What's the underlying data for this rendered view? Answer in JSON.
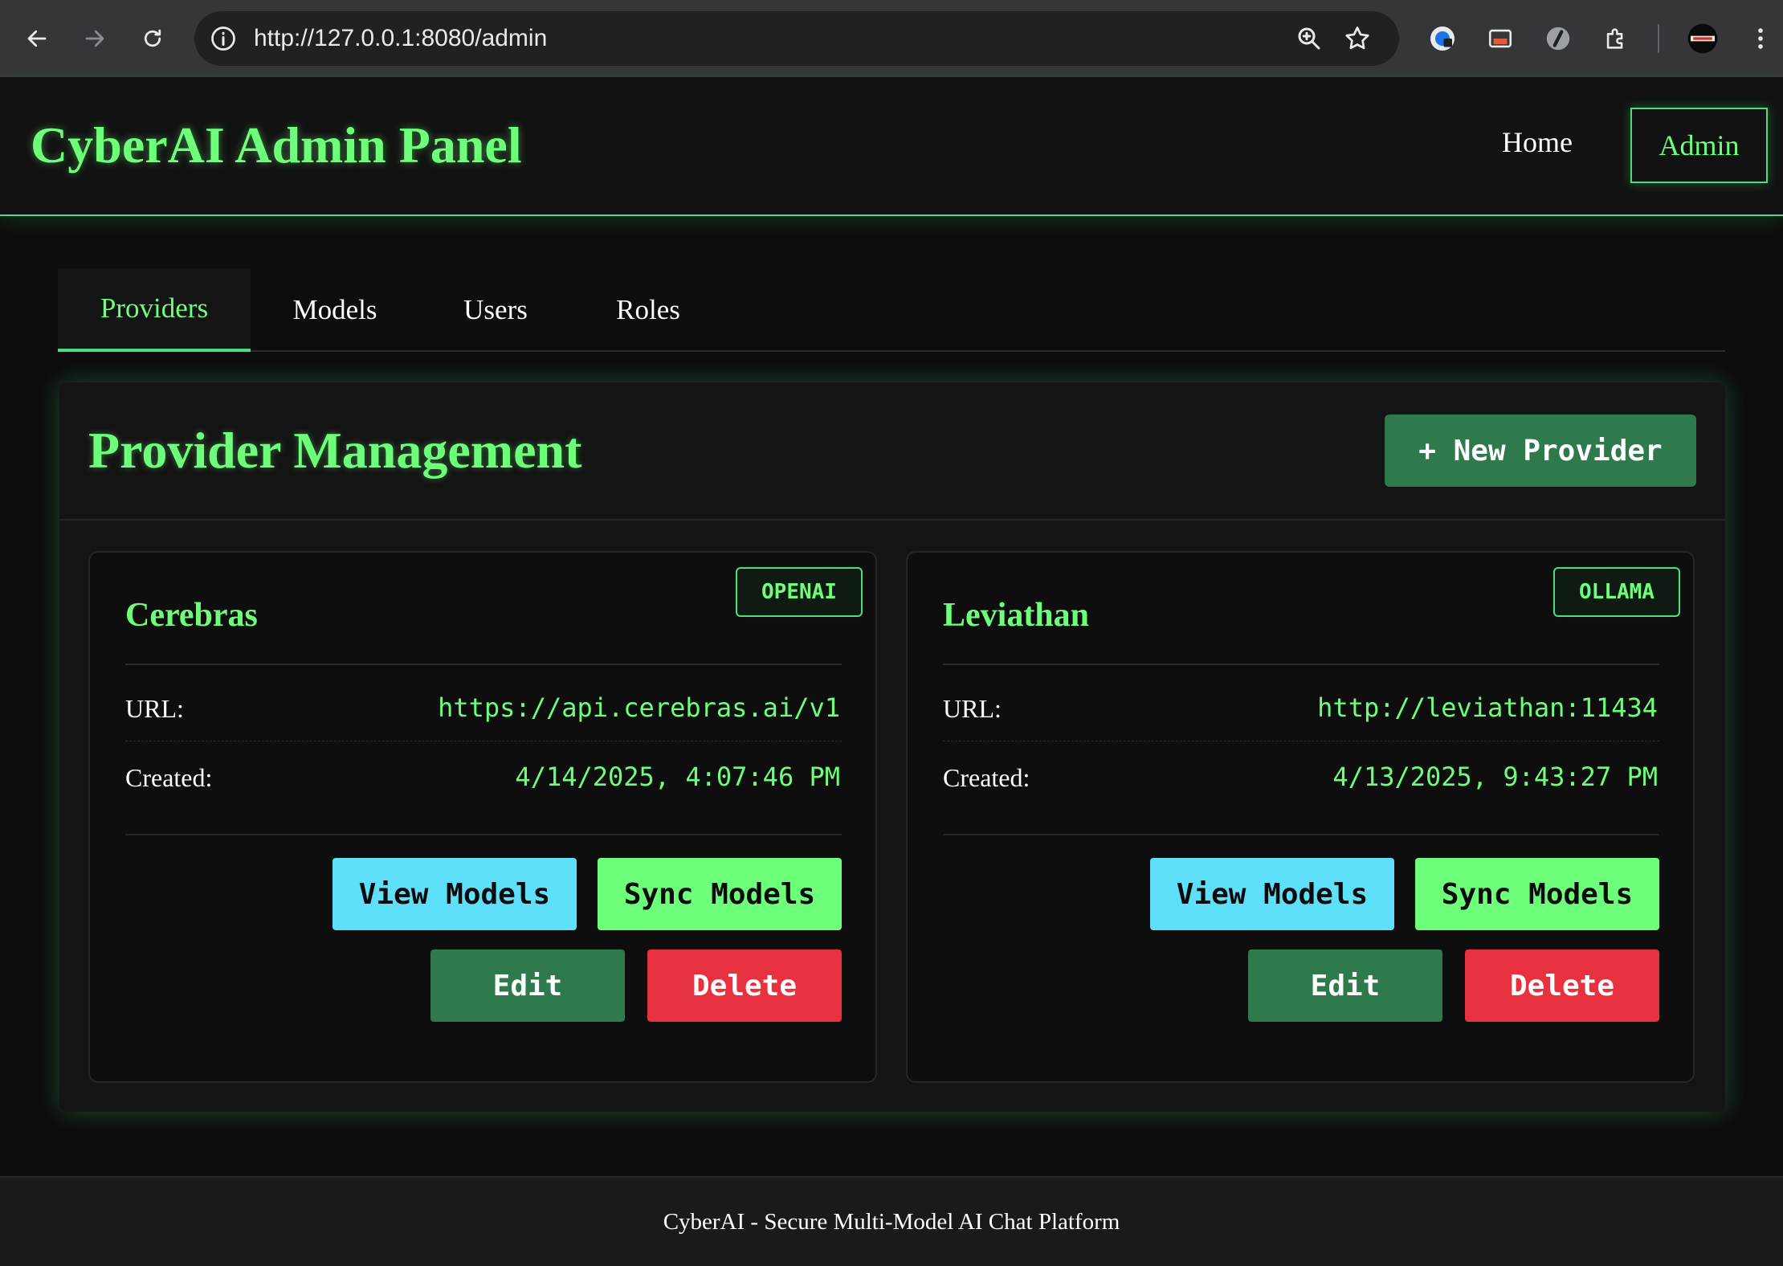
{
  "browser": {
    "url": "http://127.0.0.1:8080/admin",
    "icons": [
      "back-icon",
      "forward-icon",
      "reload-icon",
      "info-icon",
      "zoom-icon",
      "star-icon",
      "extension-icons",
      "puzzle-icon",
      "avatar",
      "menu-icon"
    ]
  },
  "header": {
    "brand": "CyberAI Admin Panel",
    "nav": {
      "home": "Home",
      "admin": "Admin"
    }
  },
  "tabs": [
    {
      "label": "Providers",
      "active": true
    },
    {
      "label": "Models",
      "active": false
    },
    {
      "label": "Users",
      "active": false
    },
    {
      "label": "Roles",
      "active": false
    }
  ],
  "panel": {
    "title": "Provider Management",
    "new_button": "+ New Provider"
  },
  "providers": [
    {
      "name": "Cerebras",
      "type": "OPENAI",
      "url_label": "URL:",
      "url": "https://api.cerebras.ai/v1",
      "created_label": "Created:",
      "created": "4/14/2025, 4:07:46 PM",
      "actions": {
        "view": "View Models",
        "sync": "Sync Models",
        "edit": "Edit",
        "delete": "Delete"
      }
    },
    {
      "name": "Leviathan",
      "type": "OLLAMA",
      "url_label": "URL:",
      "url": "http://leviathan:11434",
      "created_label": "Created:",
      "created": "4/13/2025, 9:43:27 PM",
      "actions": {
        "view": "View Models",
        "sync": "Sync Models",
        "edit": "Edit",
        "delete": "Delete"
      }
    }
  ],
  "footer": {
    "text": "CyberAI - Secure Multi-Model AI Chat Platform"
  },
  "colors": {
    "accent": "#6dff7a",
    "view_button": "#5ee0fb",
    "edit_button": "#2e7a4c",
    "delete_button": "#e8313f",
    "background": "#0d0d0d"
  }
}
